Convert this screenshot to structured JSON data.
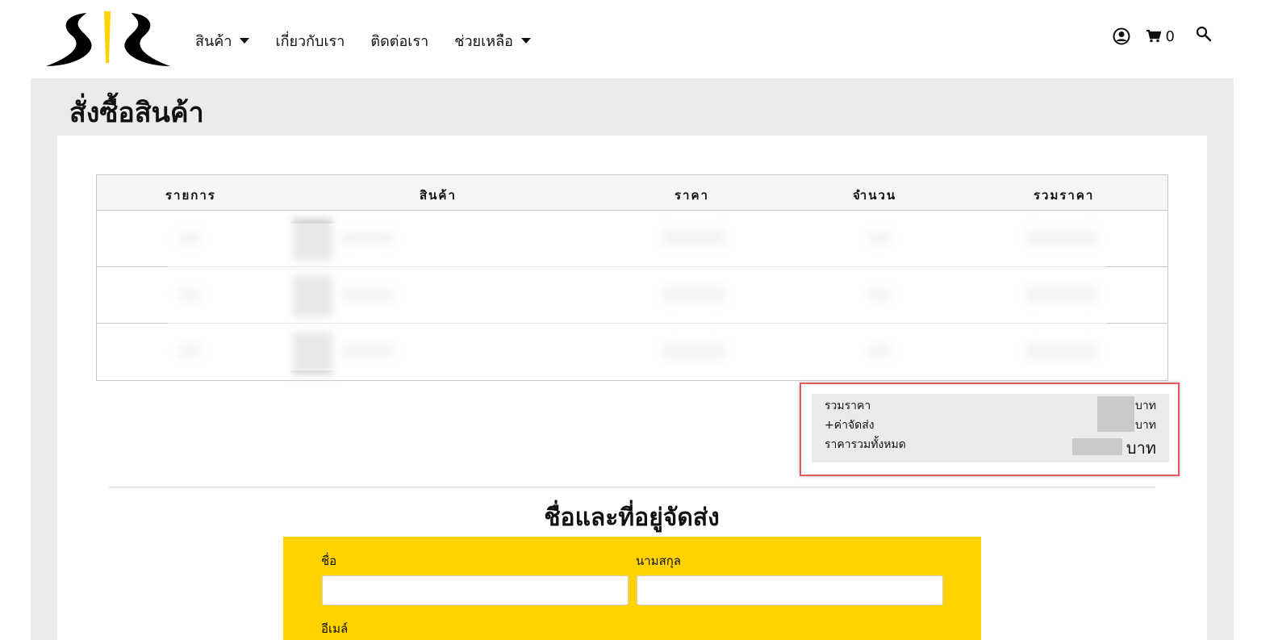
{
  "header": {
    "logo_alt": "SZ",
    "nav": [
      {
        "label": "สินค้า",
        "has_dropdown": true
      },
      {
        "label": "เกี่ยวกับเรา",
        "has_dropdown": false
      },
      {
        "label": "ติดต่อเรา",
        "has_dropdown": false
      },
      {
        "label": "ช่วยเหลือ",
        "has_dropdown": true
      }
    ],
    "cart_count": "0",
    "icons": [
      "account-icon",
      "cart-icon",
      "search-icon"
    ]
  },
  "page": {
    "title": "สั่งซื้อสินค้า"
  },
  "order_table": {
    "columns": [
      "รายการ",
      "สินค้า",
      "ราคา",
      "จำนวน",
      "รวมราคา"
    ],
    "row_count": 3
  },
  "summary": {
    "subtotal_label": "รวมราคา",
    "shipping_label": "+ค่าจัดส่ง",
    "total_label": "ราคารวมทั้งหมด",
    "unit": "บาท"
  },
  "shipping_section": {
    "title": "ชื่อและที่อยู่จัดส่ง",
    "first_name_label": "ชื่อ",
    "last_name_label": "นามสกุล",
    "email_label": "อีเมล์",
    "first_name_value": "",
    "last_name_value": ""
  },
  "colors": {
    "brand_yellow": "#ffd200",
    "panel_gray": "#ebebeb",
    "highlight_red": "#e05a5a"
  }
}
